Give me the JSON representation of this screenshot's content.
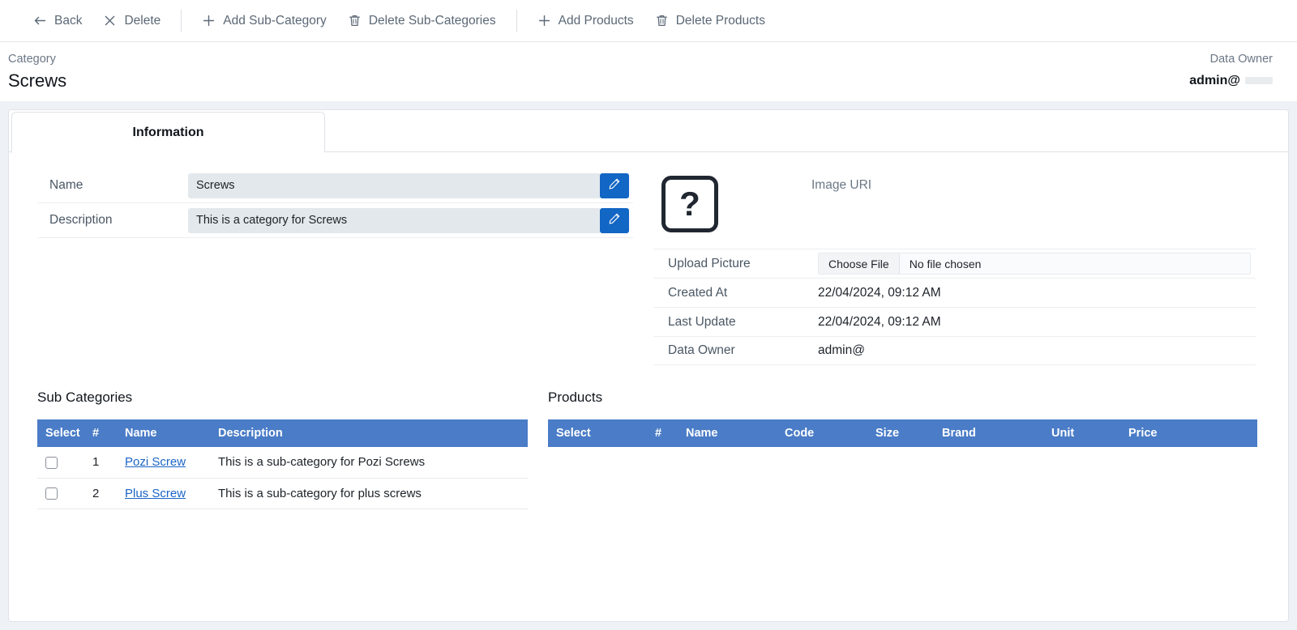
{
  "toolbar": {
    "buttons": [
      {
        "label": "Back",
        "icon": "arrow-left-icon"
      },
      {
        "label": "Delete",
        "icon": "close-x-icon"
      },
      {
        "label": "Add Sub-Category",
        "icon": "plus-icon"
      },
      {
        "label": "Delete Sub-Categories",
        "icon": "trash-icon"
      },
      {
        "label": "Add Products",
        "icon": "plus-icon"
      },
      {
        "label": "Delete Products",
        "icon": "trash-icon"
      }
    ]
  },
  "header": {
    "kicker": "Category",
    "title": "Screws",
    "owner_label": "Data Owner",
    "owner_value": "admin@"
  },
  "tabs": [
    {
      "label": "Information",
      "active": true
    }
  ],
  "form": {
    "rows": [
      {
        "label": "Name",
        "value": "Screws",
        "edit_icon": "pencil-icon"
      },
      {
        "label": "Description",
        "value": "This is a category for Screws",
        "edit_icon": "pencil-icon"
      }
    ]
  },
  "image": {
    "placeholder_glyph": "?",
    "uri_label": "Image URI"
  },
  "meta": {
    "upload_label": "Upload Picture",
    "choose_file_label": "Choose File",
    "no_file_label": "No file chosen",
    "rows": [
      {
        "label": "Created At",
        "value": "22/04/2024, 09:12 AM"
      },
      {
        "label": "Last Update",
        "value": "22/04/2024, 09:12 AM"
      },
      {
        "label": "Data Owner",
        "value": "admin@"
      }
    ]
  },
  "subcategories": {
    "title": "Sub Categories",
    "columns": [
      "Select",
      "#",
      "Name",
      "Description"
    ],
    "rows": [
      {
        "num": "1",
        "name": "Pozi Screw",
        "description": "This is a sub-category for Pozi Screws"
      },
      {
        "num": "2",
        "name": "Plus Screw",
        "description": "This is a sub-category for plus screws"
      }
    ]
  },
  "products": {
    "title": "Products",
    "columns": [
      "Select",
      "#",
      "Name",
      "Code",
      "Size",
      "Brand",
      "Unit",
      "Price"
    ],
    "rows": []
  },
  "colors": {
    "accent_blue": "#1266c4",
    "table_header_blue": "#4a7cc7",
    "link_blue": "#1b64c6",
    "page_bg": "#eef1f5"
  }
}
